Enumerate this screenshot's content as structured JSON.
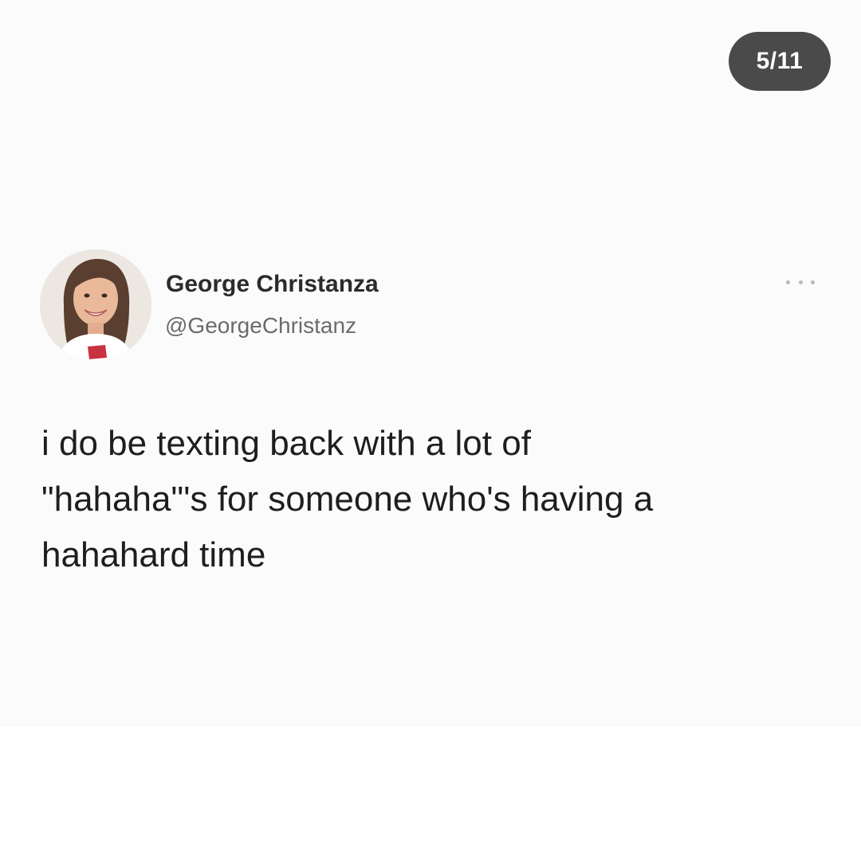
{
  "viewer": {
    "page_counter": "5/11"
  },
  "tweet": {
    "display_name": "George Christanza",
    "handle": "@GeorgeChristanz",
    "text_lines": [
      "i do be texting back with a lot of",
      "\"hahaha\"'s for someone who's having a",
      "hahahard time"
    ],
    "avatar_icon": "profile-photo",
    "more_icon": "more-options-icon"
  },
  "colors": {
    "page_background": "#ffffff",
    "tweet_background": "#fbfbfb",
    "counter_background": "#4a4a4a",
    "name_color": "#2b2b2b",
    "handle_color": "#6b6b6b",
    "text_color": "#1e1e1e"
  }
}
